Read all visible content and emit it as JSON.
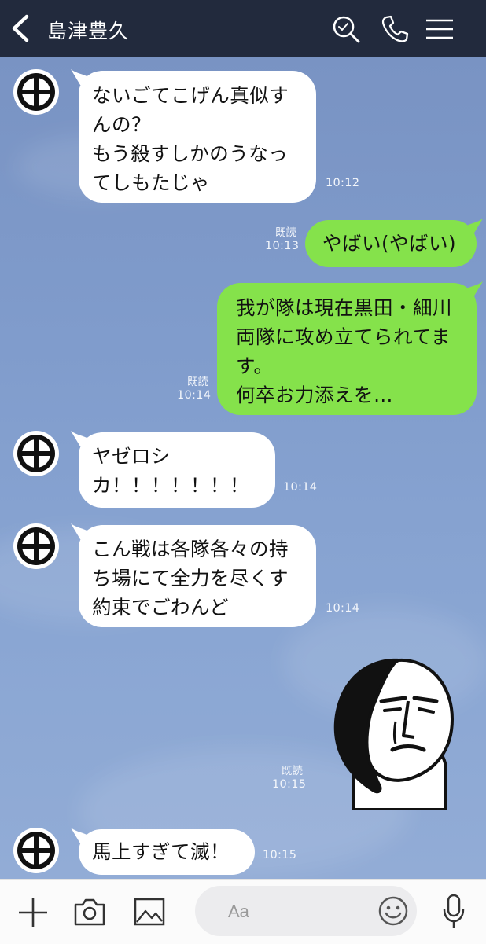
{
  "header": {
    "title": "島津豊久"
  },
  "messages": [
    {
      "lines": [
        "ないごてこげん真似す",
        "んの？",
        "もう殺すしかのうなっ",
        "てしもたじゃ"
      ],
      "time": "10:12"
    },
    {
      "lines": [
        "やばい(やばい)"
      ],
      "read": "既読",
      "time": "10:13"
    },
    {
      "lines": [
        "我が隊は現在黒田・細川",
        "両隊に攻め立てられてま",
        "す。",
        "何卒お力添えを…"
      ],
      "read": "既読",
      "time": "10:14"
    },
    {
      "lines": [
        "ヤゼロシ",
        "カ！！！！！！！"
      ],
      "time": "10:14"
    },
    {
      "lines": [
        "こん戦は各隊各々の持",
        "ち場にて全力を尽くす",
        "約束でごわんど"
      ],
      "time": "10:14"
    },
    {
      "sticker": "stern-face-sticker",
      "read": "既読",
      "time": "10:15"
    },
    {
      "lines": [
        "馬上すぎて滅！"
      ],
      "time": "10:15"
    }
  ],
  "input": {
    "placeholder": "Aa"
  },
  "icons": {
    "header": [
      "back-arrow-icon",
      "search-icon",
      "phone-icon",
      "menu-icon"
    ],
    "avatar": "shimazu-crest-icon",
    "bar": [
      "plus-icon",
      "camera-icon",
      "image-icon",
      "emoji-icon",
      "microphone-icon"
    ]
  },
  "colors": {
    "header": "#222a3d",
    "outgoing_bubble": "#85e24b",
    "incoming_bubble": "#ffffff",
    "chat_background": "#7f9bc8"
  }
}
